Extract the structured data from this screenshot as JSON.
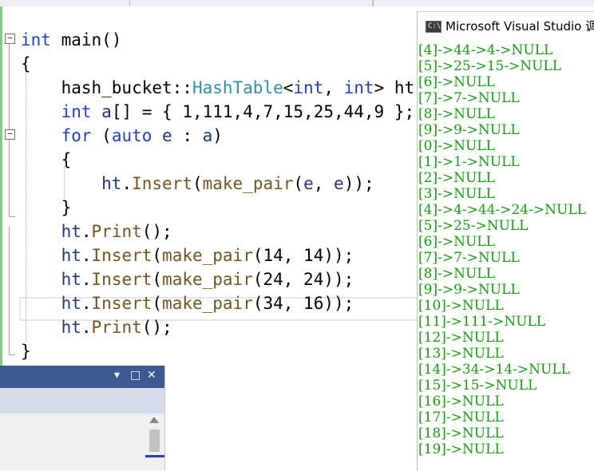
{
  "editor": {
    "lines": [
      {
        "parts": [
          {
            "t": "int",
            "c": "kw"
          },
          {
            "t": " main()",
            "c": ""
          }
        ]
      },
      {
        "parts": [
          {
            "t": "{",
            "c": ""
          }
        ]
      },
      {
        "parts": [
          {
            "t": "    hash_bucket::",
            "c": ""
          },
          {
            "t": "HashTable",
            "c": "ty"
          },
          {
            "t": "<",
            "c": ""
          },
          {
            "t": "int",
            "c": "kw"
          },
          {
            "t": ", ",
            "c": ""
          },
          {
            "t": "int",
            "c": "kw"
          },
          {
            "t": "> ht;",
            "c": ""
          }
        ]
      },
      {
        "parts": [
          {
            "t": "    ",
            "c": ""
          },
          {
            "t": "int",
            "c": "kw"
          },
          {
            "t": " ",
            "c": ""
          },
          {
            "t": "a",
            "c": "id"
          },
          {
            "t": "[] = { 1,111,4,7,15,25,44,9 };",
            "c": ""
          }
        ]
      },
      {
        "parts": [
          {
            "t": "    ",
            "c": ""
          },
          {
            "t": "for",
            "c": "kw"
          },
          {
            "t": " (",
            "c": ""
          },
          {
            "t": "auto",
            "c": "kw"
          },
          {
            "t": " ",
            "c": ""
          },
          {
            "t": "e",
            "c": "id"
          },
          {
            "t": " : ",
            "c": ""
          },
          {
            "t": "a",
            "c": "id"
          },
          {
            "t": ")",
            "c": ""
          }
        ]
      },
      {
        "parts": [
          {
            "t": "    {",
            "c": ""
          }
        ]
      },
      {
        "parts": [
          {
            "t": "        ",
            "c": ""
          },
          {
            "t": "ht",
            "c": "id"
          },
          {
            "t": ".",
            "c": ""
          },
          {
            "t": "Insert",
            "c": "fn"
          },
          {
            "t": "(",
            "c": ""
          },
          {
            "t": "make_pair",
            "c": "fn"
          },
          {
            "t": "(",
            "c": ""
          },
          {
            "t": "e",
            "c": "id"
          },
          {
            "t": ", ",
            "c": ""
          },
          {
            "t": "e",
            "c": "id"
          },
          {
            "t": "));",
            "c": ""
          }
        ]
      },
      {
        "parts": [
          {
            "t": "    }",
            "c": ""
          }
        ]
      },
      {
        "parts": [
          {
            "t": "    ",
            "c": ""
          },
          {
            "t": "ht",
            "c": "id"
          },
          {
            "t": ".",
            "c": ""
          },
          {
            "t": "Print",
            "c": "fn"
          },
          {
            "t": "();",
            "c": ""
          }
        ]
      },
      {
        "parts": [
          {
            "t": "    ",
            "c": ""
          },
          {
            "t": "ht",
            "c": "id"
          },
          {
            "t": ".",
            "c": ""
          },
          {
            "t": "Insert",
            "c": "fn"
          },
          {
            "t": "(",
            "c": ""
          },
          {
            "t": "make_pair",
            "c": "fn"
          },
          {
            "t": "(14, 14));",
            "c": ""
          }
        ]
      },
      {
        "parts": [
          {
            "t": "    ",
            "c": ""
          },
          {
            "t": "ht",
            "c": "id"
          },
          {
            "t": ".",
            "c": ""
          },
          {
            "t": "Insert",
            "c": "fn"
          },
          {
            "t": "(",
            "c": ""
          },
          {
            "t": "make_pair",
            "c": "fn"
          },
          {
            "t": "(24, 24));",
            "c": ""
          }
        ]
      },
      {
        "parts": [
          {
            "t": "    ",
            "c": ""
          },
          {
            "t": "ht",
            "c": "id"
          },
          {
            "t": ".",
            "c": ""
          },
          {
            "t": "Insert",
            "c": "fn"
          },
          {
            "t": "(",
            "c": ""
          },
          {
            "t": "make_pair",
            "c": "fn"
          },
          {
            "t": "(34, 16));",
            "c": ""
          }
        ]
      },
      {
        "parts": [
          {
            "t": "    ",
            "c": ""
          },
          {
            "t": "ht",
            "c": "id"
          },
          {
            "t": ".",
            "c": ""
          },
          {
            "t": "Print",
            "c": "fn"
          },
          {
            "t": "();",
            "c": ""
          }
        ]
      },
      {
        "parts": [
          {
            "t": "}",
            "c": ""
          }
        ]
      }
    ],
    "fold_markers": [
      "−",
      "−"
    ]
  },
  "console": {
    "title": "Microsoft Visual Studio 调",
    "icon_label": "C:\\",
    "lines": [
      "[4]->44->4->NULL",
      "[5]->25->15->NULL",
      "[6]->NULL",
      "[7]->7->NULL",
      "[8]->NULL",
      "[9]->9->NULL",
      "[0]->NULL",
      "[1]->1->NULL",
      "[2]->NULL",
      "[3]->NULL",
      "[4]->4->44->24->NULL",
      "[5]->25->NULL",
      "[6]->NULL",
      "[7]->7->NULL",
      "[8]->NULL",
      "[9]->9->NULL",
      "[10]->NULL",
      "[11]->111->NULL",
      "[12]->NULL",
      "[13]->NULL",
      "[14]->34->14->NULL",
      "[15]->15->NULL",
      "[16]->NULL",
      "[17]->NULL",
      "[18]->NULL",
      "[19]->NULL"
    ]
  },
  "toolwindow": {
    "dropdown_icon": "▾",
    "maximize_icon": "□",
    "close_icon": "✕"
  },
  "colors": {
    "keyword": "#1f3fc8",
    "type": "#2b91af",
    "function": "#74531f",
    "console_text": "#13a10e",
    "toolwindow_title": "#3e5a93"
  }
}
